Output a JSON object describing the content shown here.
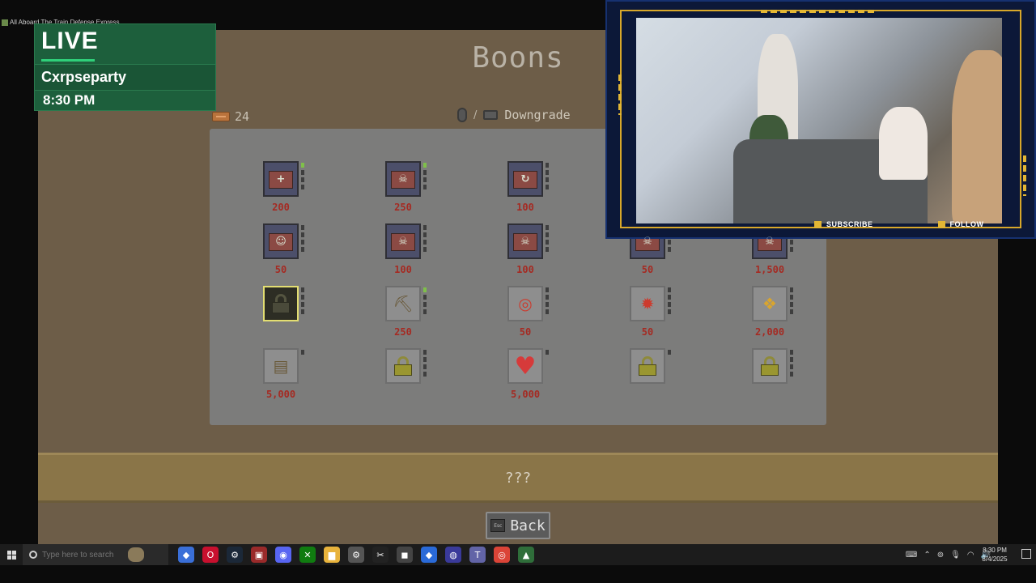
{
  "window": {
    "title": "All Aboard The Train Defense Express"
  },
  "overlay": {
    "live_label": "LIVE",
    "channel_name": "Cxrpseparty",
    "time": "8:30 PM"
  },
  "game": {
    "title": "Boons",
    "currency_amount": "24",
    "hint_separator": "/",
    "hint_label": "Downgrade",
    "description": "???",
    "back_label": "Back",
    "back_key": "Esc",
    "boons": [
      {
        "row": 0,
        "col": 0,
        "icon": "chest-health-icon",
        "glyph": "+",
        "kind": "chest",
        "price": "200",
        "levels": 4,
        "filled": 1
      },
      {
        "row": 0,
        "col": 1,
        "icon": "chest-skull-icon",
        "glyph": "☠",
        "kind": "chest",
        "price": "250",
        "levels": 4,
        "filled": 1
      },
      {
        "row": 0,
        "col": 2,
        "icon": "chest-recycle-icon",
        "glyph": "↻",
        "kind": "chest",
        "price": "100",
        "levels": 4,
        "filled": 0
      },
      {
        "row": 1,
        "col": 0,
        "icon": "chest-ghost-icon",
        "glyph": "☺",
        "kind": "chest",
        "price": "50",
        "levels": 4,
        "filled": 0
      },
      {
        "row": 1,
        "col": 1,
        "icon": "chest-skull-icon",
        "glyph": "☠",
        "kind": "chest",
        "price": "100",
        "levels": 4,
        "filled": 0
      },
      {
        "row": 1,
        "col": 2,
        "icon": "chest-skull-icon",
        "glyph": "☠",
        "kind": "chest",
        "price": "100",
        "levels": 4,
        "filled": 0
      },
      {
        "row": 1,
        "col": 3,
        "icon": "chest-skull-icon",
        "glyph": "☠",
        "kind": "chest",
        "price": "50",
        "levels": 4,
        "filled": 0
      },
      {
        "row": 1,
        "col": 4,
        "icon": "chest-skull-icon",
        "glyph": "☠",
        "kind": "chest",
        "price": "1,500",
        "levels": 4,
        "filled": 0
      },
      {
        "row": 2,
        "col": 0,
        "icon": "lock-icon",
        "glyph": "",
        "kind": "darklock",
        "price": "",
        "levels": 4,
        "filled": 0
      },
      {
        "row": 2,
        "col": 1,
        "icon": "pickaxe-icon",
        "glyph": "⛏",
        "kind": "plain",
        "price": "250",
        "levels": 4,
        "filled": 1
      },
      {
        "row": 2,
        "col": 2,
        "icon": "target-icon",
        "glyph": "◎",
        "kind": "plain",
        "price": "50",
        "levels": 4,
        "filled": 0
      },
      {
        "row": 2,
        "col": 3,
        "icon": "explosion-icon",
        "glyph": "✹",
        "kind": "plain",
        "price": "50",
        "levels": 4,
        "filled": 0
      },
      {
        "row": 2,
        "col": 4,
        "icon": "treasure-chest-icon",
        "glyph": "❖",
        "kind": "plain",
        "price": "2,000",
        "levels": 4,
        "filled": 0
      },
      {
        "row": 3,
        "col": 0,
        "icon": "arcade-machine-icon",
        "glyph": "▤",
        "kind": "plain",
        "price": "5,000",
        "levels": 1,
        "filled": 0
      },
      {
        "row": 3,
        "col": 1,
        "icon": "lock-icon",
        "glyph": "",
        "kind": "lock",
        "price": "",
        "levels": 4,
        "filled": 0
      },
      {
        "row": 3,
        "col": 2,
        "icon": "heart-plus-icon",
        "glyph": "♥",
        "kind": "heart",
        "price": "5,000",
        "levels": 1,
        "filled": 0
      },
      {
        "row": 3,
        "col": 3,
        "icon": "lock-icon",
        "glyph": "",
        "kind": "lock",
        "price": "",
        "levels": 1,
        "filled": 0
      },
      {
        "row": 3,
        "col": 4,
        "icon": "lock-icon",
        "glyph": "",
        "kind": "lock",
        "price": "",
        "levels": 4,
        "filled": 0
      }
    ]
  },
  "cam": {
    "subscribe_label": "SUBSCRIBE",
    "follow_label": "FOLLOW"
  },
  "taskbar": {
    "search_placeholder": "Type here to search",
    "apps": [
      "copilot-icon",
      "opera-icon",
      "steam-icon",
      "media-icon",
      "discord-icon",
      "xbox-icon",
      "file-explorer-icon",
      "settings-icon",
      "capcut-icon",
      "roblox-icon",
      "app-icon",
      "obs-icon",
      "teams-icon",
      "chrome-icon",
      "game-icon"
    ],
    "clock_time": "8:30 PM",
    "clock_date": "8/4/2025"
  },
  "colors": {
    "price_red": "#a52a22",
    "level_on": "#7fc04a",
    "overlay_green": "#1d5f3c",
    "cam_gold": "#e3b634"
  }
}
